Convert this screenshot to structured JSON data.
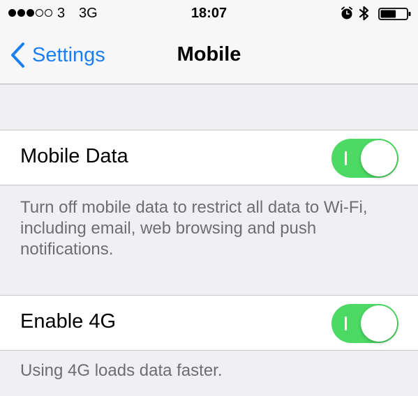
{
  "status_bar": {
    "carrier": "3",
    "network": "3G",
    "time": "18:07",
    "signal_strength": 3,
    "signal_max": 5,
    "icons": [
      "alarm-icon",
      "bluetooth-icon",
      "battery-icon"
    ],
    "battery_level": 0.6
  },
  "nav": {
    "back_label": "Settings",
    "title": "Mobile"
  },
  "settings": {
    "mobile_data": {
      "label": "Mobile Data",
      "enabled": true,
      "footer": "Turn off mobile data to restrict all data to Wi-Fi, including email, web browsing and push notifications."
    },
    "enable_4g": {
      "label": "Enable 4G",
      "enabled": true,
      "footer": "Using 4G loads data faster."
    }
  },
  "colors": {
    "accent": "#1a7ff5",
    "toggle_on": "#4cd964",
    "footer_text": "#6d6d72",
    "group_background": "#efeff4"
  }
}
